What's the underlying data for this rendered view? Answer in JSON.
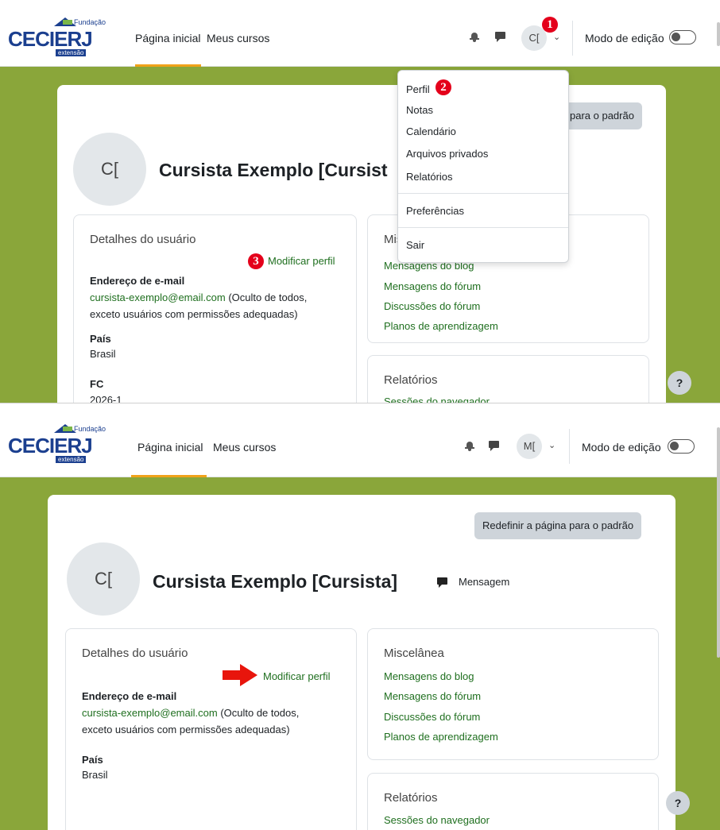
{
  "colors": {
    "accent_underline": "#f0a21a",
    "link_green": "#1f6f1f",
    "page_background_olive": "#8aa63a",
    "badge_red": "#e4001b",
    "arrow_red": "#e8150c",
    "brand_blue": "#1b3f8f"
  },
  "logo": {
    "top_text": "Fundação",
    "main_text": "CECIERJ",
    "sub_text": "extensão"
  },
  "screen1": {
    "navbar": {
      "home_label": "Página inicial",
      "courses_label": "Meus cursos",
      "bell_icon": "bell-icon",
      "chat_icon": "chat-icon",
      "avatar_initials": "C[",
      "edit_mode_label": "Modo de edição"
    },
    "badges": {
      "one": "1",
      "two": "2",
      "three": "3"
    },
    "dropdown": {
      "items": [
        "Perfil",
        "Notas",
        "Calendário",
        "Arquivos privados",
        "Relatórios"
      ],
      "preferences": "Preferências",
      "logout": "Sair"
    },
    "profile": {
      "reset_label": "para o padrão",
      "avatar_initials": "C[",
      "name": "Cursista Exemplo [Cursist"
    },
    "details": {
      "title": "Detalhes do usuário",
      "edit_link": "Modificar perfil",
      "email_label": "Endereço de e-mail",
      "email_value": "cursista-exemplo@email.com",
      "email_note_1": " (Oculto de todos,",
      "email_note_2": "exceto usuários com permissões adequadas)",
      "country_label": "País",
      "country_value": "Brasil",
      "fc_label": "FC",
      "fc_value": "2026-1"
    },
    "misc": {
      "title": "Mis",
      "links": [
        "Mensagens do blog",
        "Mensagens do fórum",
        "Discussões do fórum",
        "Planos de aprendizagem"
      ]
    },
    "reports": {
      "title": "Relatórios",
      "links": [
        "Sessões do navegador"
      ]
    },
    "help_label": "?"
  },
  "screen2": {
    "navbar": {
      "home_label": "Página inicial",
      "courses_label": "Meus cursos",
      "bell_icon": "bell-icon",
      "chat_icon": "chat-icon",
      "avatar_initials": "M[",
      "edit_mode_label": "Modo de edição"
    },
    "profile": {
      "reset_label": "Redefinir a página para o padrão",
      "avatar_initials": "C[",
      "name": "Cursista Exemplo [Cursista]",
      "message_label": "Mensagem",
      "message_icon": "chat-icon"
    },
    "details": {
      "title": "Detalhes do usuário",
      "edit_link": "Modificar perfil",
      "email_label": "Endereço de e-mail",
      "email_value": "cursista-exemplo@email.com",
      "email_note_1": " (Oculto de todos,",
      "email_note_2": "exceto usuários com permissões adequadas)",
      "country_label": "País",
      "country_value": "Brasil"
    },
    "misc": {
      "title": "Miscelânea",
      "links": [
        "Mensagens do blog",
        "Mensagens do fórum",
        "Discussões do fórum",
        "Planos de aprendizagem"
      ]
    },
    "reports": {
      "title": "Relatórios",
      "links": [
        "Sessões do navegador"
      ]
    },
    "help_label": "?"
  }
}
